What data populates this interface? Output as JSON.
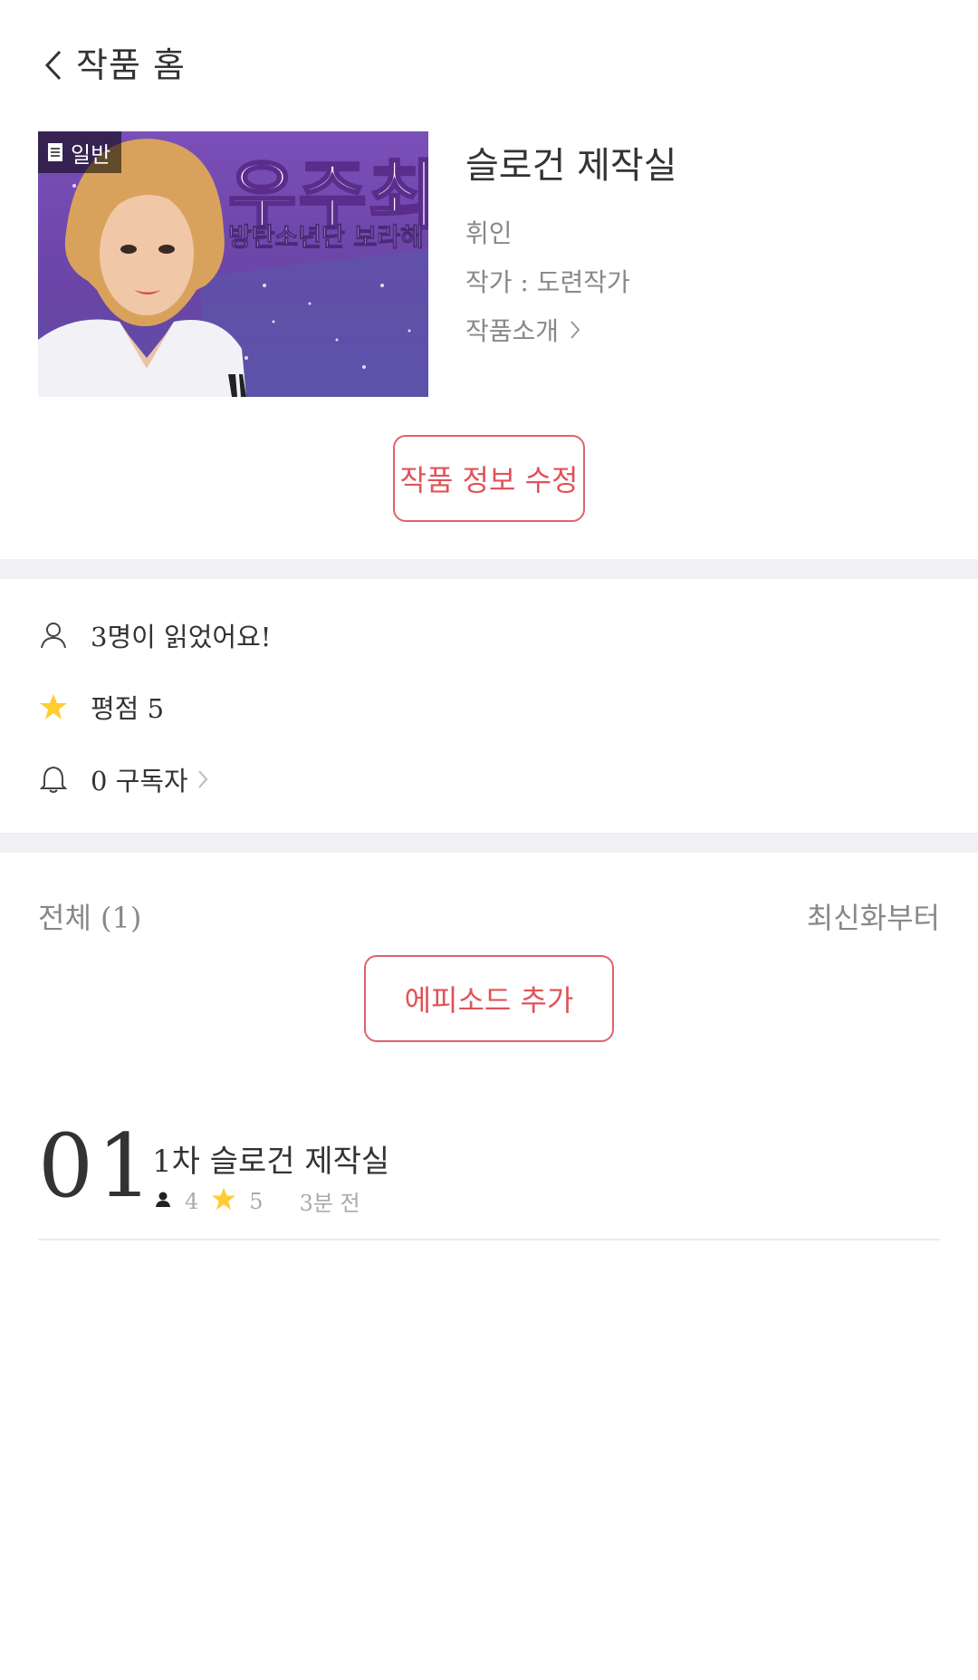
{
  "header": {
    "title": "작품 홈"
  },
  "cover": {
    "badge": "일반",
    "headline": "우주최",
    "subline": "방탄소년단 보라해"
  },
  "work": {
    "title": "슬로건 제작실",
    "genre": "휘인",
    "author": "작가 : 도련작가",
    "intro_link": "작품소개"
  },
  "buttons": {
    "edit": "작품 정보 수정",
    "add_episode": "에피소드 추가"
  },
  "stats": {
    "readers": "3명이 읽었어요!",
    "rating": "평점 5",
    "subscribers": "0 구독자"
  },
  "list": {
    "count_label": "전체 (1)",
    "sort_label": "최신화부터"
  },
  "episodes": [
    {
      "number": "01",
      "title": "1차 슬로건 제작실",
      "views": "4",
      "rating": "5",
      "time": "3분 전"
    }
  ],
  "colors": {
    "accent": "#e05358",
    "star": "#ffcc33",
    "band": "#f1f1f3"
  }
}
